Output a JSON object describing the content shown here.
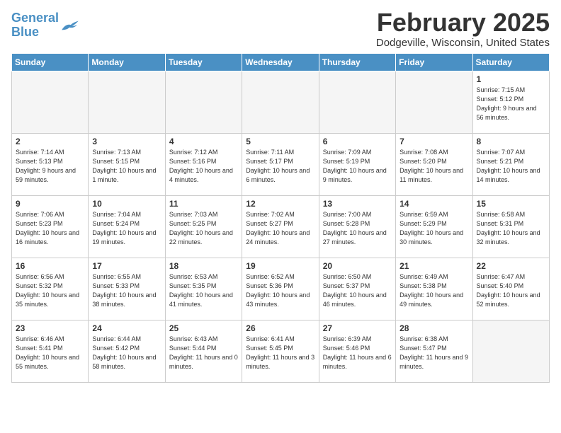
{
  "header": {
    "logo_line1": "General",
    "logo_line2": "Blue",
    "title": "February 2025",
    "location": "Dodgeville, Wisconsin, United States"
  },
  "days_of_week": [
    "Sunday",
    "Monday",
    "Tuesday",
    "Wednesday",
    "Thursday",
    "Friday",
    "Saturday"
  ],
  "weeks": [
    [
      {
        "day": "",
        "info": ""
      },
      {
        "day": "",
        "info": ""
      },
      {
        "day": "",
        "info": ""
      },
      {
        "day": "",
        "info": ""
      },
      {
        "day": "",
        "info": ""
      },
      {
        "day": "",
        "info": ""
      },
      {
        "day": "1",
        "info": "Sunrise: 7:15 AM\nSunset: 5:12 PM\nDaylight: 9 hours and 56 minutes."
      }
    ],
    [
      {
        "day": "2",
        "info": "Sunrise: 7:14 AM\nSunset: 5:13 PM\nDaylight: 9 hours and 59 minutes."
      },
      {
        "day": "3",
        "info": "Sunrise: 7:13 AM\nSunset: 5:15 PM\nDaylight: 10 hours and 1 minute."
      },
      {
        "day": "4",
        "info": "Sunrise: 7:12 AM\nSunset: 5:16 PM\nDaylight: 10 hours and 4 minutes."
      },
      {
        "day": "5",
        "info": "Sunrise: 7:11 AM\nSunset: 5:17 PM\nDaylight: 10 hours and 6 minutes."
      },
      {
        "day": "6",
        "info": "Sunrise: 7:09 AM\nSunset: 5:19 PM\nDaylight: 10 hours and 9 minutes."
      },
      {
        "day": "7",
        "info": "Sunrise: 7:08 AM\nSunset: 5:20 PM\nDaylight: 10 hours and 11 minutes."
      },
      {
        "day": "8",
        "info": "Sunrise: 7:07 AM\nSunset: 5:21 PM\nDaylight: 10 hours and 14 minutes."
      }
    ],
    [
      {
        "day": "9",
        "info": "Sunrise: 7:06 AM\nSunset: 5:23 PM\nDaylight: 10 hours and 16 minutes."
      },
      {
        "day": "10",
        "info": "Sunrise: 7:04 AM\nSunset: 5:24 PM\nDaylight: 10 hours and 19 minutes."
      },
      {
        "day": "11",
        "info": "Sunrise: 7:03 AM\nSunset: 5:25 PM\nDaylight: 10 hours and 22 minutes."
      },
      {
        "day": "12",
        "info": "Sunrise: 7:02 AM\nSunset: 5:27 PM\nDaylight: 10 hours and 24 minutes."
      },
      {
        "day": "13",
        "info": "Sunrise: 7:00 AM\nSunset: 5:28 PM\nDaylight: 10 hours and 27 minutes."
      },
      {
        "day": "14",
        "info": "Sunrise: 6:59 AM\nSunset: 5:29 PM\nDaylight: 10 hours and 30 minutes."
      },
      {
        "day": "15",
        "info": "Sunrise: 6:58 AM\nSunset: 5:31 PM\nDaylight: 10 hours and 32 minutes."
      }
    ],
    [
      {
        "day": "16",
        "info": "Sunrise: 6:56 AM\nSunset: 5:32 PM\nDaylight: 10 hours and 35 minutes."
      },
      {
        "day": "17",
        "info": "Sunrise: 6:55 AM\nSunset: 5:33 PM\nDaylight: 10 hours and 38 minutes."
      },
      {
        "day": "18",
        "info": "Sunrise: 6:53 AM\nSunset: 5:35 PM\nDaylight: 10 hours and 41 minutes."
      },
      {
        "day": "19",
        "info": "Sunrise: 6:52 AM\nSunset: 5:36 PM\nDaylight: 10 hours and 43 minutes."
      },
      {
        "day": "20",
        "info": "Sunrise: 6:50 AM\nSunset: 5:37 PM\nDaylight: 10 hours and 46 minutes."
      },
      {
        "day": "21",
        "info": "Sunrise: 6:49 AM\nSunset: 5:38 PM\nDaylight: 10 hours and 49 minutes."
      },
      {
        "day": "22",
        "info": "Sunrise: 6:47 AM\nSunset: 5:40 PM\nDaylight: 10 hours and 52 minutes."
      }
    ],
    [
      {
        "day": "23",
        "info": "Sunrise: 6:46 AM\nSunset: 5:41 PM\nDaylight: 10 hours and 55 minutes."
      },
      {
        "day": "24",
        "info": "Sunrise: 6:44 AM\nSunset: 5:42 PM\nDaylight: 10 hours and 58 minutes."
      },
      {
        "day": "25",
        "info": "Sunrise: 6:43 AM\nSunset: 5:44 PM\nDaylight: 11 hours and 0 minutes."
      },
      {
        "day": "26",
        "info": "Sunrise: 6:41 AM\nSunset: 5:45 PM\nDaylight: 11 hours and 3 minutes."
      },
      {
        "day": "27",
        "info": "Sunrise: 6:39 AM\nSunset: 5:46 PM\nDaylight: 11 hours and 6 minutes."
      },
      {
        "day": "28",
        "info": "Sunrise: 6:38 AM\nSunset: 5:47 PM\nDaylight: 11 hours and 9 minutes."
      },
      {
        "day": "",
        "info": ""
      }
    ]
  ]
}
